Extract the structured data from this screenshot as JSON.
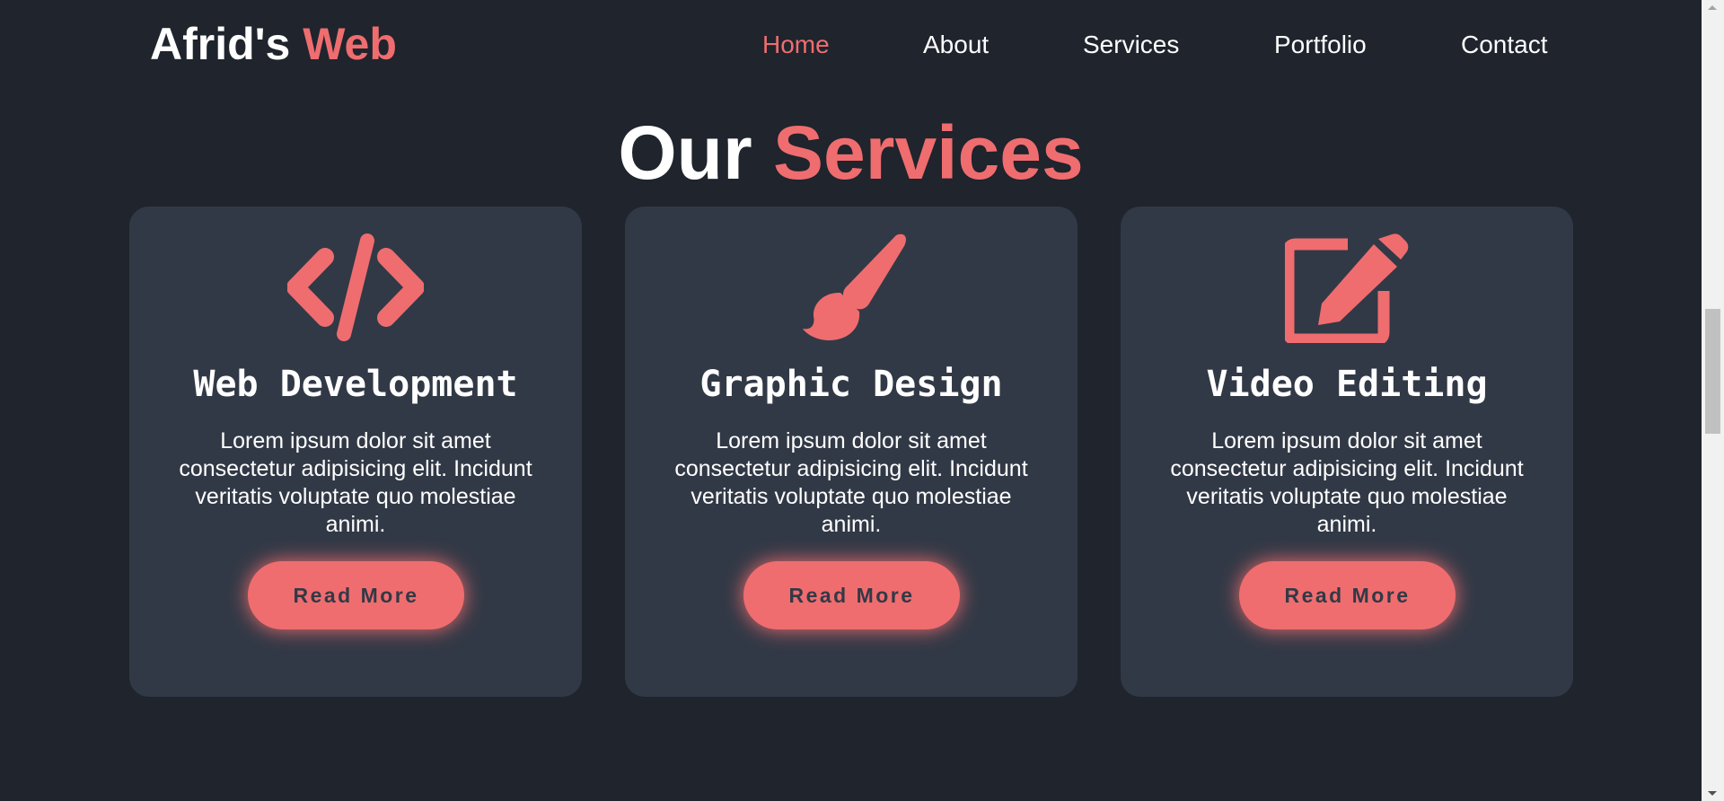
{
  "header": {
    "logo_main": "Afrid's ",
    "logo_accent": "Web",
    "nav": [
      {
        "label": "Home",
        "active": true
      },
      {
        "label": "About",
        "active": false
      },
      {
        "label": "Services",
        "active": false
      },
      {
        "label": "Portfolio",
        "active": false
      },
      {
        "label": "Contact",
        "active": false
      }
    ]
  },
  "section": {
    "heading_main": "Our ",
    "heading_accent": "Services"
  },
  "services": [
    {
      "icon": "code-icon",
      "title": "Web Development",
      "description": "Lorem ipsum dolor sit amet consectetur adipisicing elit. Incidunt veritatis voluptate quo molestiae animi.",
      "button": "Read More"
    },
    {
      "icon": "paintbrush-icon",
      "title": "Graphic Design",
      "description": "Lorem ipsum dolor sit amet consectetur adipisicing elit. Incidunt veritatis voluptate quo molestiae animi.",
      "button": "Read More"
    },
    {
      "icon": "edit-icon",
      "title": "Video Editing",
      "description": "Lorem ipsum dolor sit amet consectetur adipisicing elit. Incidunt veritatis voluptate quo molestiae animi.",
      "button": "Read More"
    }
  ],
  "colors": {
    "background": "#1f242d",
    "card": "#323946",
    "accent": "#ef6d6f",
    "text": "#ffffff"
  }
}
